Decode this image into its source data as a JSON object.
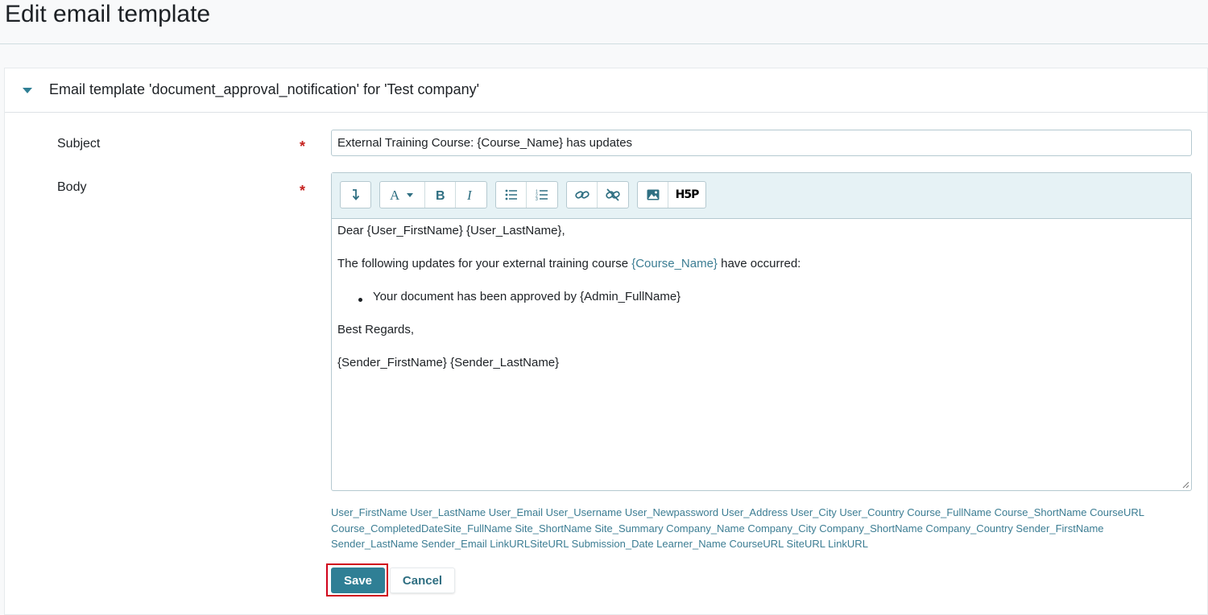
{
  "page": {
    "title": "Edit email template"
  },
  "card": {
    "title": "Email template 'document_approval_notification' for 'Test company'"
  },
  "form": {
    "subject_label": "Subject",
    "body_label": "Body",
    "required_mark": "*",
    "subject_value": "External Training Course: {Course_Name} has updates"
  },
  "toolbar": {
    "buttons": [
      "collapse-toolbar",
      "text-style",
      "bold",
      "italic",
      "unordered-list",
      "ordered-list",
      "link",
      "unlink",
      "image",
      "h5p"
    ],
    "h5p_label": "H5P"
  },
  "body": {
    "greeting": "Dear {User_FirstName} {User_LastName},",
    "intro_before": "The following updates for your external training course ",
    "intro_placeholder": "{Course_Name}",
    "intro_after": " have occurred:",
    "bullet": "Your document has been approved by {Admin_FullName}",
    "closing": "Best Regards,",
    "signature": "{Sender_FirstName} {Sender_LastName}"
  },
  "placeholders": {
    "line1": "User_FirstName User_LastName User_Email User_Username User_Newpassword User_Address User_City User_Country Course_FullName Course_ShortName CourseURL",
    "line2": "Course_CompletedDateSite_FullName Site_ShortName Site_Summary Company_Name Company_City Company_ShortName Company_Country Sender_FirstName",
    "line3": "Sender_LastName Sender_Email LinkURLSiteURL Submission_Date Learner_Name CourseURL SiteURL LinkURL"
  },
  "actions": {
    "save": "Save",
    "cancel": "Cancel"
  },
  "colors": {
    "accent": "#2f7f95",
    "required": "#c5221f",
    "highlight": "#d0021b"
  }
}
